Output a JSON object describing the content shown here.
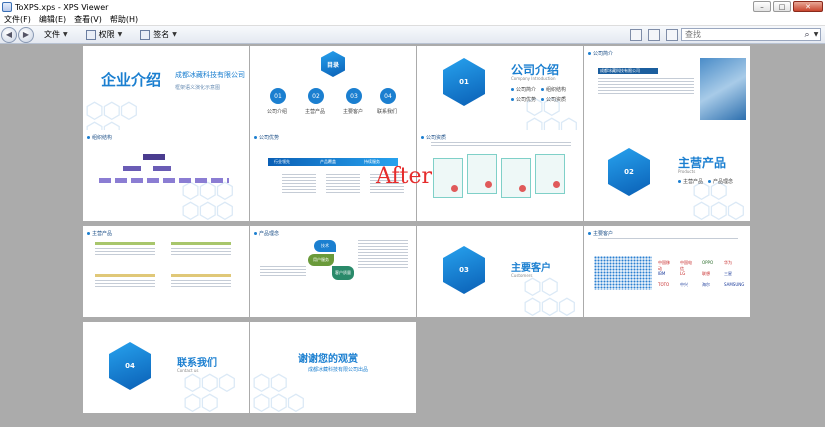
{
  "window": {
    "title": "ToXPS.xps - XPS Viewer",
    "minimize_glyph": "–",
    "maximize_glyph": "□",
    "close_glyph": "✕"
  },
  "menu": {
    "file": "文件(F)",
    "edit": "编辑(E)",
    "view": "查看(V)",
    "help": "帮助(H)"
  },
  "toolbar": {
    "file_label": "文件",
    "permissions_label": "权限",
    "signature_label": "签名",
    "search_placeholder": "查找",
    "back_glyph": "◀",
    "forward_glyph": "▶"
  },
  "watermark": "After",
  "slides": {
    "s1": {
      "title": "企业介绍",
      "company": "成都冰藏科技有限公司",
      "tagline": "框架语义演化示意图"
    },
    "s2": {
      "badge": "目录",
      "items": [
        {
          "num": "01",
          "label": "公司介绍"
        },
        {
          "num": "02",
          "label": "主营产品"
        },
        {
          "num": "03",
          "label": "主要客户"
        },
        {
          "num": "04",
          "label": "联系我们"
        }
      ]
    },
    "s3": {
      "hex": "01",
      "title": "公司介绍",
      "subtitle": "Company Introduction",
      "bullets": [
        "公司简介",
        "组织结构",
        "公司优势",
        "公司资质"
      ]
    },
    "s4": {
      "head": "公司简介",
      "banner": "成都冰藏科技有限公司"
    },
    "s5": {
      "head": "组织结构"
    },
    "s6": {
      "head": "公司优势",
      "steps": [
        "行业领先",
        "产品覆盖",
        "持续服务"
      ]
    },
    "s7": {
      "head": "公司资质"
    },
    "s8": {
      "hex": "02",
      "title": "主营产品",
      "subtitle": "Products",
      "bullets": [
        "主营产品",
        "产品理念"
      ]
    },
    "s9": {
      "head": "主营产品"
    },
    "s10": {
      "head": "产品理念",
      "pills": [
        "技术",
        "用户服务",
        "客户质量"
      ]
    },
    "s11": {
      "hex": "03",
      "title": "主要客户",
      "subtitle": "Customers"
    },
    "s12": {
      "head": "主要客户",
      "logos": [
        "中国移动",
        "中国电信",
        "OPPO",
        "华为",
        "IBM",
        "LG",
        "联想",
        "三星",
        "TOTO",
        "中兴",
        "海尔",
        "SAMSUNG"
      ]
    },
    "s13": {
      "hex": "04",
      "title": "联系我们",
      "subtitle": "Contact us"
    },
    "s14": {
      "title": "谢谢您的观赏",
      "subtitle": "成都冰藏科技有限公司出品"
    }
  }
}
